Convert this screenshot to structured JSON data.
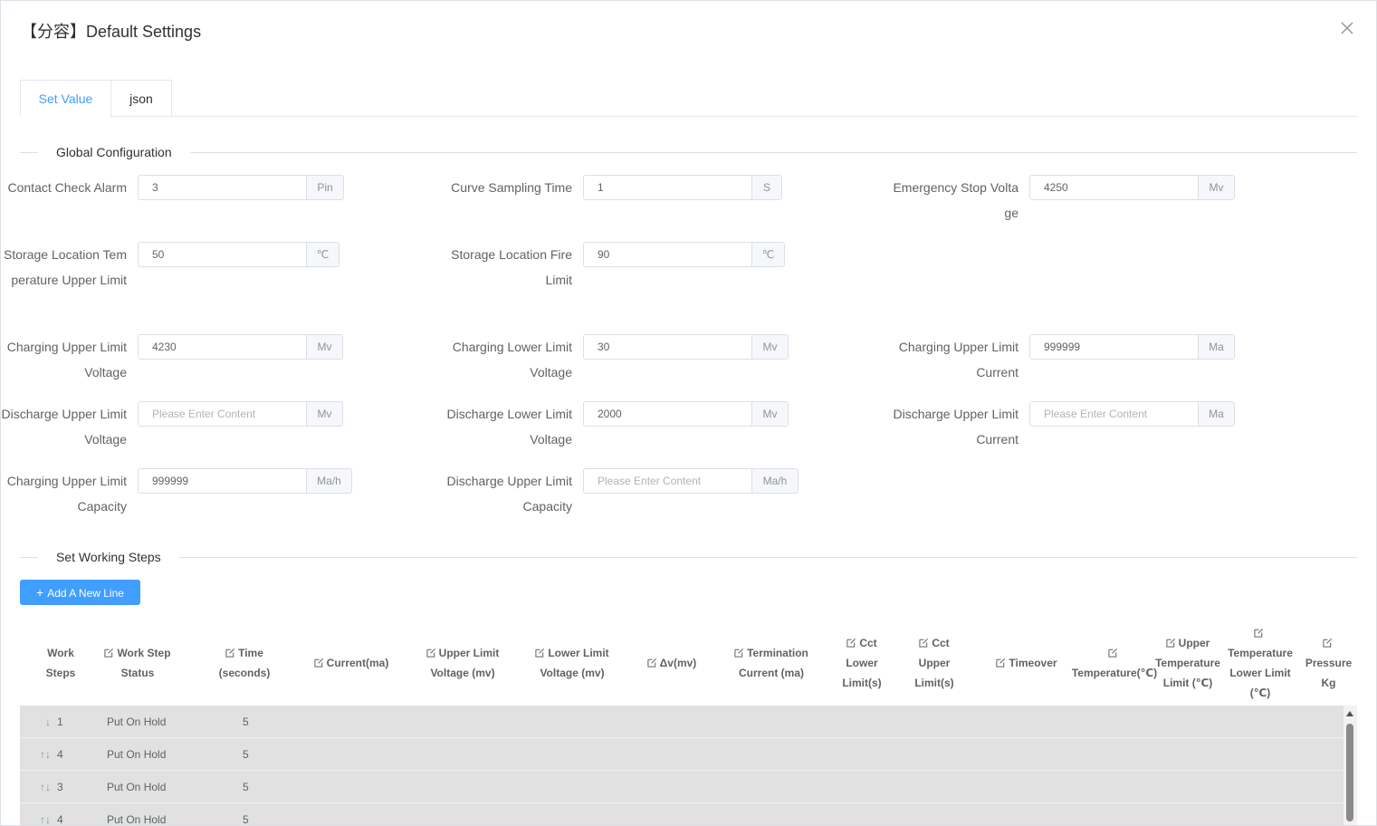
{
  "dialog": {
    "title": "【分容】Default Settings",
    "close_icon": "close-icon"
  },
  "tabs": [
    {
      "label": "Set Value",
      "active": true
    },
    {
      "label": "json",
      "active": false
    }
  ],
  "global_config": {
    "title": "Global Configuration",
    "fields": [
      {
        "label": "Contact Check Alarm",
        "value": "3",
        "placeholder": "Please Enter Content",
        "unit": "Pin"
      },
      {
        "label": "Curve Sampling Time",
        "value": "1",
        "placeholder": "Please Enter Content",
        "unit": "S"
      },
      {
        "label": "Emergency Stop Voltage",
        "value": "4250",
        "placeholder": "Please Enter Content",
        "unit": "Mv"
      },
      {
        "label": "Storage Location Temperature Upper Limit",
        "value": "50",
        "placeholder": "Please Enter Content",
        "unit": "℃"
      },
      {
        "label": "Storage Location Fire Limit",
        "value": "90",
        "placeholder": "Please Enter Content",
        "unit": "℃"
      },
      {
        "label": "Charging Upper Limit Voltage",
        "value": "4230",
        "placeholder": "Please Enter Content",
        "unit": "Mv"
      },
      {
        "label": "Charging Lower Limit Voltage",
        "value": "30",
        "placeholder": "Please Enter Content",
        "unit": "Mv"
      },
      {
        "label": "Charging Upper Limit Current",
        "value": "999999",
        "placeholder": "Please Enter Content",
        "unit": "Ma"
      },
      {
        "label": "Discharge Upper Limit Voltage",
        "value": "",
        "placeholder": "Please Enter Content",
        "unit": "Mv"
      },
      {
        "label": "Discharge Lower Limit Voltage",
        "value": "2000",
        "placeholder": "Please Enter Content",
        "unit": "Mv"
      },
      {
        "label": "Discharge Upper Limit Current",
        "value": "",
        "placeholder": "Please Enter Content",
        "unit": "Ma"
      },
      {
        "label": "Charging Upper Limit Capacity",
        "value": "999999",
        "placeholder": "Please Enter Content",
        "unit": "Ma/h"
      },
      {
        "label": "Discharge Upper Limit Capacity",
        "value": "",
        "placeholder": "Please Enter Content",
        "unit": "Ma/h"
      }
    ]
  },
  "working_steps": {
    "title": "Set Working Steps",
    "add_button": "Add A New Line",
    "columns": [
      {
        "label": "Work Steps",
        "editable": false
      },
      {
        "label": "Work Step Status",
        "editable": true
      },
      {
        "label": "Time (seconds)",
        "editable": true
      },
      {
        "label": "Current(ma)",
        "editable": true
      },
      {
        "label": "Upper Limit Voltage (mv)",
        "editable": true
      },
      {
        "label": "Lower Limit Voltage (mv)",
        "editable": true
      },
      {
        "label": "Δv(mv)",
        "editable": true
      },
      {
        "label": "Termination Current (ma)",
        "editable": true
      },
      {
        "label": "Cct Lower Limit(s)",
        "editable": true
      },
      {
        "label": "Cct Upper Limit(s)",
        "editable": true
      },
      {
        "label": "Timeover",
        "editable": true
      },
      {
        "label": "Temperature(℃)",
        "editable": true
      },
      {
        "label": "Upper Temperature Limit (℃)",
        "editable": true
      },
      {
        "label": "Temperature Lower Limit (℃)",
        "editable": true
      },
      {
        "label": "Pressure Kg",
        "editable": true
      }
    ],
    "rows": [
      {
        "arrows": "↓",
        "step": "1",
        "status": "Put On Hold",
        "time": "5"
      },
      {
        "arrows": "↑↓",
        "step": "4",
        "status": "Put On Hold",
        "time": "5"
      },
      {
        "arrows": "↑↓",
        "step": "3",
        "status": "Put On Hold",
        "time": "5"
      },
      {
        "arrows": "↑↓",
        "step": "4",
        "status": "Put On Hold",
        "time": "5"
      }
    ]
  }
}
